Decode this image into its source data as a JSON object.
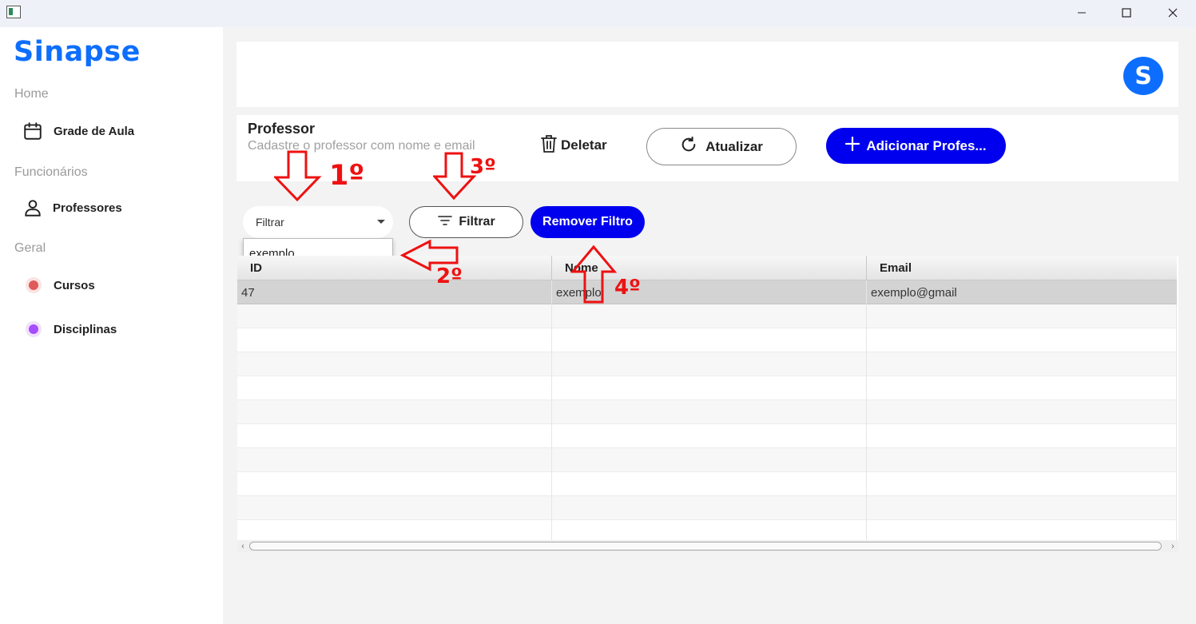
{
  "window": {
    "title": "",
    "controls": {
      "minimize": "minimize-icon",
      "maximize": "maximize-icon",
      "close": "close-icon"
    }
  },
  "sidebar": {
    "brand": "Sinapse",
    "sections": [
      {
        "title": "Home",
        "items": [
          {
            "label": "Grade de Aula",
            "icon": "calendar-icon"
          }
        ]
      },
      {
        "title": "Funcionários",
        "items": [
          {
            "label": "Professores",
            "icon": "user-icon"
          }
        ]
      },
      {
        "title": "Geral",
        "items": [
          {
            "label": "Cursos",
            "icon": "dot-icon",
            "color": "#e05a5a"
          },
          {
            "label": "Disciplinas",
            "icon": "dot-icon",
            "color": "#a64dff"
          }
        ]
      }
    ]
  },
  "header": {
    "avatar_letter": "S",
    "avatar_color": "#0d6efd"
  },
  "page": {
    "title": "Professor",
    "subtitle": "Cadastre o professor com nome e email",
    "actions": {
      "delete_label": "Deletar",
      "refresh_label": "Atualizar",
      "add_label": "Adicionar Profes..."
    }
  },
  "filter": {
    "select_value": "Filtrar",
    "dropdown_options": [
      "exemplo"
    ],
    "filter_button_label": "Filtrar",
    "remove_filter_label": "Remover Filtro"
  },
  "table": {
    "columns": [
      "ID",
      "Nome",
      "Email"
    ],
    "rows": [
      {
        "id": "47",
        "nome": "exemplo",
        "email": "exemplo@gmail",
        "selected": true
      }
    ],
    "empty_rows": 10
  },
  "annotations": {
    "labels": [
      "1º",
      "2º",
      "3º",
      "4º"
    ],
    "color": "#ee1111"
  },
  "colors": {
    "brand": "#0d6efd",
    "primary_button": "#0000ee",
    "annotation": "#ee1111"
  }
}
